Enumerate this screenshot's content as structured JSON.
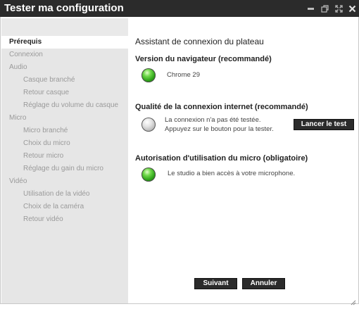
{
  "window": {
    "title": "Tester ma configuration",
    "controls": [
      {
        "name": "minimize-icon"
      },
      {
        "name": "restore-icon"
      },
      {
        "name": "maximize-icon"
      },
      {
        "name": "close-icon"
      }
    ]
  },
  "sidebar": {
    "items": [
      {
        "label": "Prérequis",
        "level": 1,
        "active": true
      },
      {
        "label": "Connexion",
        "level": 1
      },
      {
        "label": "Audio",
        "level": 1
      },
      {
        "label": "Casque branché",
        "level": 2
      },
      {
        "label": "Retour casque",
        "level": 2
      },
      {
        "label": "Réglage du volume du casque",
        "level": 2
      },
      {
        "label": "Micro",
        "level": 1
      },
      {
        "label": "Micro branché",
        "level": 2
      },
      {
        "label": "Choix du micro",
        "level": 2
      },
      {
        "label": "Retour micro",
        "level": 2
      },
      {
        "label": "Réglage du gain du micro",
        "level": 2
      },
      {
        "label": "Vidéo",
        "level": 1
      },
      {
        "label": "Utilisation de la vidéo",
        "level": 2
      },
      {
        "label": "Choix de la caméra",
        "level": 2
      },
      {
        "label": "Retour vidéo",
        "level": 2
      }
    ]
  },
  "main": {
    "heading": "Assistant de connexion du plateau",
    "sections": {
      "browser": {
        "title": "Version du navigateur (recommandé)",
        "status": "green",
        "message": "Chrome 29"
      },
      "connection": {
        "title": "Qualité de la connexion internet (recommandé)",
        "status": "grey",
        "message_line1": "La connexion n'a pas été testée.",
        "message_line2": "Appuyez sur le bouton pour la tester.",
        "button_label": "Lancer le test"
      },
      "micro": {
        "title": "Autorisation d'utilisation du micro (obligatoire)",
        "status": "green",
        "message": "Le studio a bien accès à votre microphone."
      }
    }
  },
  "footer": {
    "next_label": "Suivant",
    "cancel_label": "Annuler"
  },
  "colors": {
    "titlebar": "#2b2b2b",
    "sidebar_bg": "#e6e6e6",
    "status_ok": "#2fa51a",
    "status_untested": "#b8b8b8",
    "button_bg": "#2b2b2b"
  }
}
